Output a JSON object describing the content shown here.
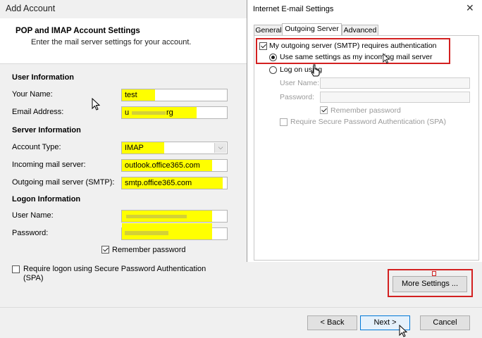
{
  "add_account": {
    "window_title": "Add Account",
    "heading": "POP and IMAP Account Settings",
    "subheading": "Enter the mail server settings for your account.",
    "user_info": {
      "section": "User Information",
      "name_label": "Your Name:",
      "name_value": "test",
      "email_label": "Email Address:",
      "email_value_prefix": "u",
      "email_value_suffix": "rg"
    },
    "server_info": {
      "section": "Server Information",
      "account_type_label": "Account Type:",
      "account_type_value": "IMAP",
      "incoming_label": "Incoming mail server:",
      "incoming_value": "outlook.office365.com",
      "outgoing_label": "Outgoing mail server (SMTP):",
      "outgoing_value": "smtp.office365.com"
    },
    "logon_info": {
      "section": "Logon Information",
      "username_label": "User Name:",
      "password_label": "Password:",
      "remember_label": "Remember password",
      "remember_checked": true,
      "spa_label": "Require logon using Secure Password Authentication",
      "spa_label_2": "(SPA)",
      "spa_checked": false
    },
    "more_settings_label": "More Settings ...",
    "back_label": "< Back",
    "next_label": "Next >",
    "cancel_label": "Cancel"
  },
  "internet_settings": {
    "title": "Internet E-mail Settings",
    "close_icon": "close-icon",
    "tabs": [
      "General",
      "Outgoing Server",
      "Advanced"
    ],
    "active_tab": "Outgoing Server",
    "smtp_auth_label": "My outgoing server (SMTP) requires authentication",
    "smtp_auth_checked": true,
    "same_settings_label": "Use same settings as my incoming mail server",
    "logon_using_label": "Log on using",
    "username_label": "User Name:",
    "password_label": "Password:",
    "remember_label": "Remember password",
    "spa_label": "Require Secure Password Authentication (SPA)"
  },
  "colors": {
    "highlight": "#ffff00",
    "annotation_red": "#d32020",
    "dialog_bg": "#f0f0f0"
  }
}
